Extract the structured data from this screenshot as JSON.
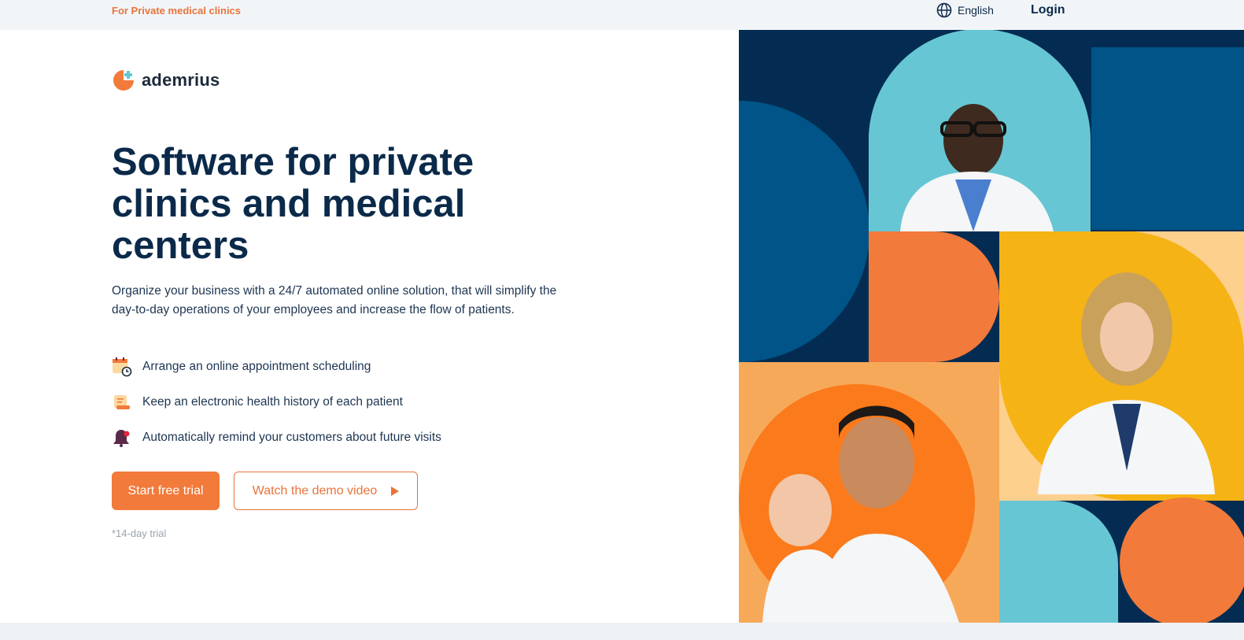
{
  "topbar": {
    "tagline": "For Private medical clinics",
    "language": "English",
    "language_icon": "globe-icon",
    "login": "Login"
  },
  "logo": {
    "wordmark": "ademrius",
    "icon": "ademrius-logo-icon"
  },
  "hero": {
    "title": "Software for private clinics and medical centers",
    "lead": "Organize your business with a 24/7 automated online solution, that will simplify the day-to-day operations of your employees and increase the flow of patients.",
    "features": [
      {
        "icon": "calendar-clock-icon",
        "label": "Arrange an online appointment scheduling"
      },
      {
        "icon": "scroll-document-icon",
        "label": "Keep an electronic health history of each patient"
      },
      {
        "icon": "notification-bell-icon",
        "label": "Automatically remind your customers about future visits"
      }
    ],
    "primary_button": "Start free trial",
    "secondary_button": "Watch the demo video",
    "trial_note": "*14-day trial"
  },
  "colors": {
    "navy": "#042c52",
    "blue": "#005487",
    "orange": "#f27a3a",
    "light_orange": "#f7a95a",
    "yellow": "#f5b315",
    "teal": "#67c6d3",
    "peach": "#fdd08e"
  }
}
